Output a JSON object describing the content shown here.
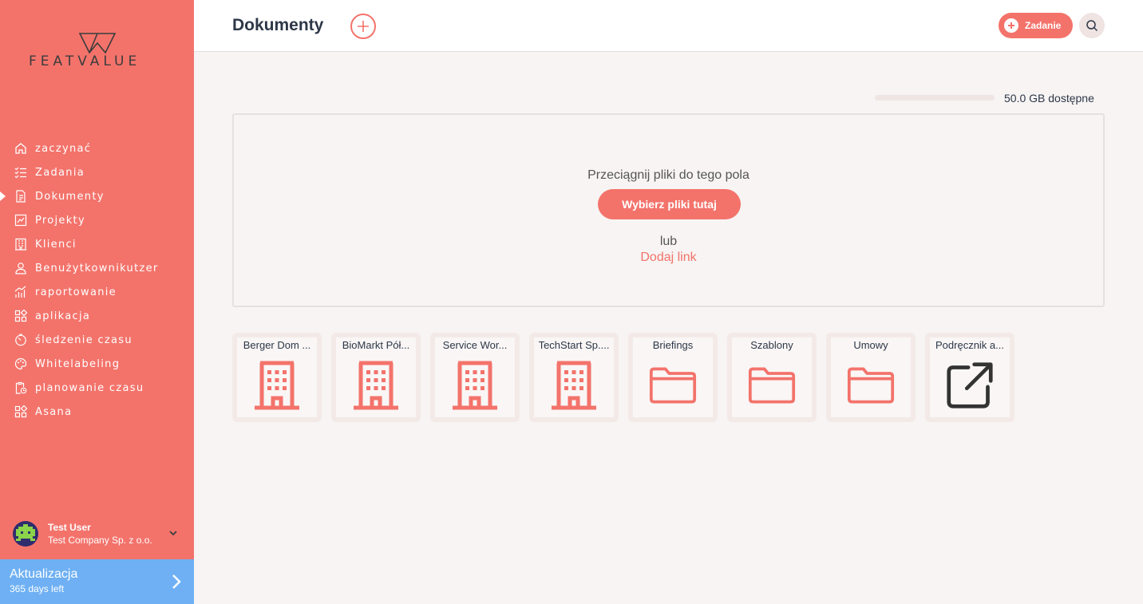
{
  "brand": {
    "name": "FEATVALUE"
  },
  "sidebar": {
    "items": [
      {
        "label": "zaczynać",
        "icon": "home-icon"
      },
      {
        "label": "Zadania",
        "icon": "checklist-icon"
      },
      {
        "label": "Dokumenty",
        "icon": "document-icon",
        "active": true
      },
      {
        "label": "Projekty",
        "icon": "chart-icon"
      },
      {
        "label": "Klienci",
        "icon": "building-icon"
      },
      {
        "label": "Benużytkownikutzer",
        "icon": "user-icon"
      },
      {
        "label": "raportowanie",
        "icon": "bar-chart-icon"
      },
      {
        "label": "aplikacja",
        "icon": "apps-icon"
      },
      {
        "label": "śledzenie czasu",
        "icon": "timer-icon"
      },
      {
        "label": "Whitelabeling",
        "icon": "palette-icon"
      },
      {
        "label": "planowanie czasu",
        "icon": "clipboard-clock-icon"
      },
      {
        "label": "Asana",
        "icon": "apps-icon"
      }
    ]
  },
  "user": {
    "name": "Test User",
    "company": "Test Company Sp. z o.o."
  },
  "upgrade": {
    "title": "Aktualizacja",
    "subtitle": "365 days left"
  },
  "header": {
    "title": "Dokumenty",
    "task_button": "Zadanie"
  },
  "storage": {
    "text": "50.0 GB dostępne",
    "used_fraction": 0
  },
  "dropzone": {
    "instruction": "Przeciągnij pliki do tego pola",
    "choose_button": "Wybierz pliki tutaj",
    "or": "lub",
    "add_link": "Dodaj link"
  },
  "tiles": [
    {
      "label": "Berger Dom ...",
      "icon": "building-icon"
    },
    {
      "label": "BioMarkt Pół...",
      "icon": "building-icon"
    },
    {
      "label": "Service Wor...",
      "icon": "building-icon"
    },
    {
      "label": "TechStart Sp....",
      "icon": "building-icon"
    },
    {
      "label": "Briefings",
      "icon": "folder-icon"
    },
    {
      "label": "Szablony",
      "icon": "folder-icon"
    },
    {
      "label": "Umowy",
      "icon": "folder-icon"
    },
    {
      "label": "Podręcznik a...",
      "icon": "external-link-icon"
    }
  ],
  "colors": {
    "accent": "#f3736b",
    "upgrade": "#6eb0f3",
    "text": "#2d3748"
  }
}
